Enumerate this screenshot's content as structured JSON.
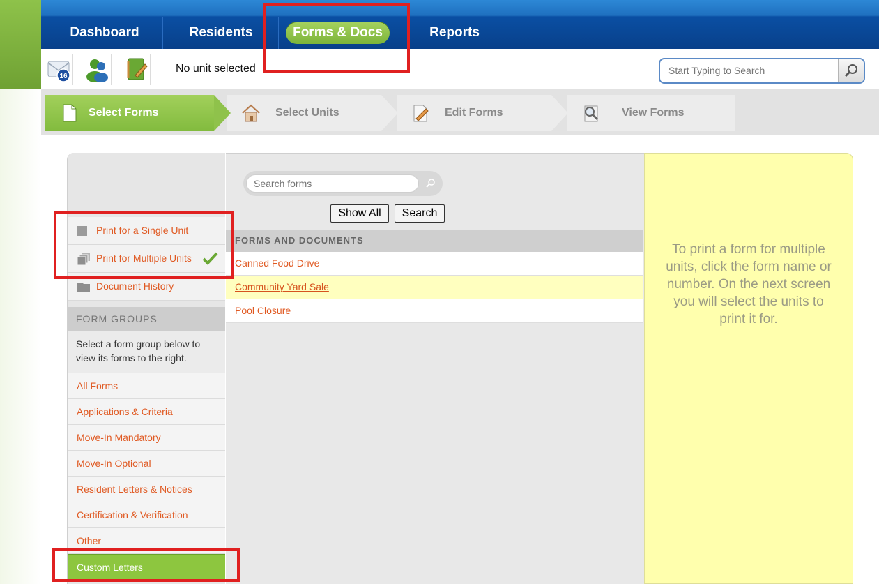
{
  "nav": {
    "items": [
      "Dashboard",
      "Residents",
      "Forms & Docs",
      "Reports"
    ],
    "active": "Forms & Docs"
  },
  "toolbar": {
    "mail_badge": "16",
    "unit_label": "No unit selected",
    "search_placeholder": "Start Typing to Search"
  },
  "steps": [
    {
      "label": "Select Forms",
      "state": "done",
      "icon": "document-icon"
    },
    {
      "label": "Select Units",
      "state": "pending",
      "icon": "house-icon"
    },
    {
      "label": "Edit Forms",
      "state": "pending",
      "icon": "pencil-icon"
    },
    {
      "label": "View Forms",
      "state": "pending",
      "icon": "magnifier-icon"
    }
  ],
  "left_panel": {
    "modes": [
      {
        "label": "Print for a Single Unit",
        "selected": false
      },
      {
        "label": "Print for Multiple Units",
        "selected": true
      }
    ],
    "history_label": "Document History",
    "groups_header": "FORM GROUPS",
    "groups_desc": "Select a form group below to view its forms to the right.",
    "groups": [
      "All Forms",
      "Applications & Criteria",
      "Move-In Mandatory",
      "Move-In Optional",
      "Resident Letters & Notices",
      "Certification & Verification",
      "Other",
      "Custom Letters"
    ],
    "selected_group": "Custom Letters"
  },
  "center_panel": {
    "search_placeholder": "Search forms",
    "show_all_label": "Show All",
    "search_label": "Search",
    "header": "FORMS AND DOCUMENTS",
    "forms": [
      "Canned Food Drive",
      "Community Yard Sale",
      "Pool Closure"
    ],
    "highlighted_form": "Community Yard Sale"
  },
  "right_panel": {
    "hint": "To print a form for multiple units, click the form name or number. On the next screen you will select the units to print it for."
  },
  "colors": {
    "nav_blue": "#0a4fa3",
    "accent_green": "#8dc63f",
    "link_orange": "#e05a23",
    "hint_yellow": "#ffffad",
    "annotation_red": "#e02020"
  }
}
